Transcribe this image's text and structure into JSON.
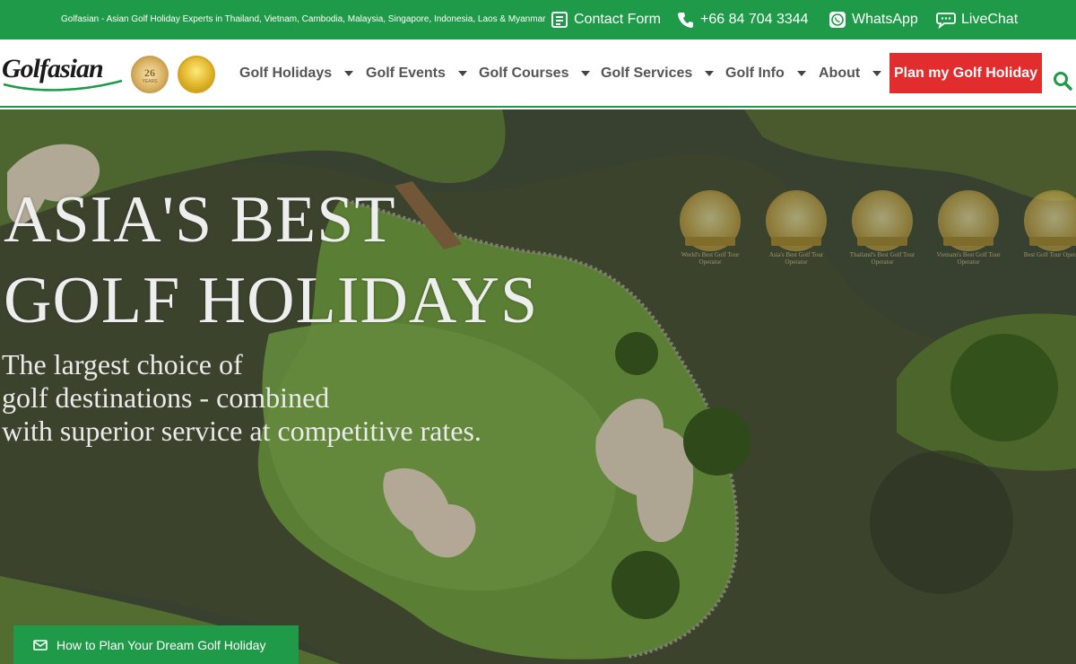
{
  "topbar": {
    "tagline": "Golfasian - Asian Golf Holiday Experts in Thailand, Vietnam, Cambodia, Malaysia, Singapore, Indonesia, Laos & Myanmar",
    "contact_form": "Contact Form",
    "phone": "+66 84 704 3344",
    "whatsapp": "WhatsApp",
    "livechat": "LiveChat"
  },
  "brand": {
    "logo": "Golfasian",
    "years_badge_number": "26",
    "years_badge_label": "YEARS",
    "colors": {
      "primary_green": "#1f9a48",
      "cta_red": "#e12d2d",
      "nav_text": "#555555"
    }
  },
  "nav": {
    "items": [
      {
        "label": "Golf Holidays"
      },
      {
        "label": "Golf Events"
      },
      {
        "label": "Golf Courses"
      },
      {
        "label": "Golf Services"
      },
      {
        "label": "Golf Info"
      },
      {
        "label": "About"
      }
    ],
    "cta": "Plan my Golf Holiday",
    "search_icon": "search-icon"
  },
  "hero": {
    "title_line1": "ASIA'S BEST",
    "title_line2": "GOLF HOLIDAYS",
    "subtitle_line1": "The largest choice of",
    "subtitle_line2": "golf destinations - combined",
    "subtitle_line3": "with superior service at competitive rates.",
    "awards": [
      {
        "caption": "World's Best Golf Tour Operator"
      },
      {
        "caption": "Asia's Best Golf Tour Operator"
      },
      {
        "caption": "Thailand's Best Golf Tour Operator"
      },
      {
        "caption": "Vietnam's Best Golf Tour Operator"
      },
      {
        "caption": "Best Golf Tour Operator"
      }
    ]
  },
  "floating_button": {
    "label": "How to Plan Your Dream Golf Holiday",
    "icon": "mail-icon"
  }
}
